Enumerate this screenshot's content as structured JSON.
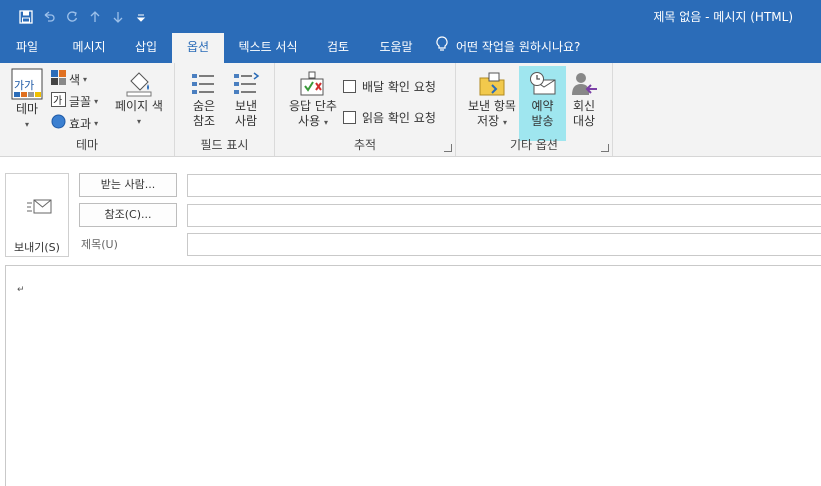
{
  "window": {
    "title": "제목 없음  -  메시지 (HTML)"
  },
  "qat": {
    "save_icon": "save-icon",
    "undo_icon": "undo-icon",
    "redo_icon": "redo-icon",
    "up_icon": "arrow-up-icon",
    "down_icon": "arrow-down-icon",
    "customize_icon": "customize-icon"
  },
  "tabs": [
    {
      "label": "파일"
    },
    {
      "label": "메시지"
    },
    {
      "label": "삽입"
    },
    {
      "label": "옵션"
    },
    {
      "label": "텍스트 서식"
    },
    {
      "label": "검토"
    },
    {
      "label": "도움말"
    }
  ],
  "tell_me": "어떤 작업을 원하시나요?",
  "ribbon": {
    "theme_group": {
      "label": "테마",
      "theme_btn": "테마",
      "color": "색",
      "font": "글꼴",
      "effects": "효과",
      "page_color": "페이지 색"
    },
    "fields_group": {
      "label": "필드 표시",
      "bcc_line1": "숨은",
      "bcc_line2": "참조",
      "from_line1": "보낸",
      "from_line2": "사람"
    },
    "tracking_group": {
      "label": "추적",
      "voting_line1": "응답 단추",
      "voting_line2": "사용",
      "delivery": "배달 확인 요청",
      "read": "읽음 확인 요청"
    },
    "more_group": {
      "label": "기타 옵션",
      "save_line1": "보낸 항목",
      "save_line2": "저장",
      "delay_line1": "예약",
      "delay_line2": "발송",
      "reply_line1": "회신",
      "reply_line2": "대상"
    }
  },
  "compose": {
    "send": "보내기(S)",
    "to_btn": "받는 사람...",
    "cc_btn": "참조(C)...",
    "subject_label": "제목(U)",
    "to_value": "",
    "cc_value": "",
    "subject_value": ""
  },
  "colors": {
    "accent": "#2b6cb8",
    "highlight": "#9fe6ef"
  }
}
